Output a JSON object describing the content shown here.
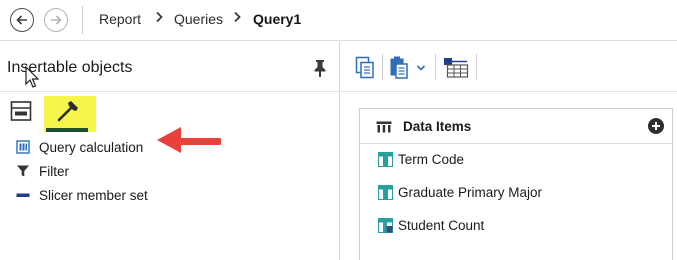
{
  "breadcrumb": {
    "items": [
      "Report",
      "Queries"
    ],
    "current": "Query1"
  },
  "left_panel": {
    "title": "Insertable objects",
    "objects": [
      {
        "label": "Query calculation",
        "icon": "query-calculation-icon"
      },
      {
        "label": "Filter",
        "icon": "filter-icon"
      },
      {
        "label": "Slicer member set",
        "icon": "slicer-member-set-icon"
      }
    ]
  },
  "data_items": {
    "title": "Data Items",
    "items": [
      {
        "label": "Term Code",
        "icon": "attribute-icon"
      },
      {
        "label": "Graduate Primary Major",
        "icon": "attribute-icon"
      },
      {
        "label": "Student Count",
        "icon": "measure-icon"
      }
    ]
  },
  "colors": {
    "highlight_tab": "#f6f64a",
    "tab_underline": "#1f4f2a",
    "annotation_arrow": "#e8413c",
    "icon_blue": "#2e6fb5",
    "icon_teal": "#2a9fa0"
  }
}
